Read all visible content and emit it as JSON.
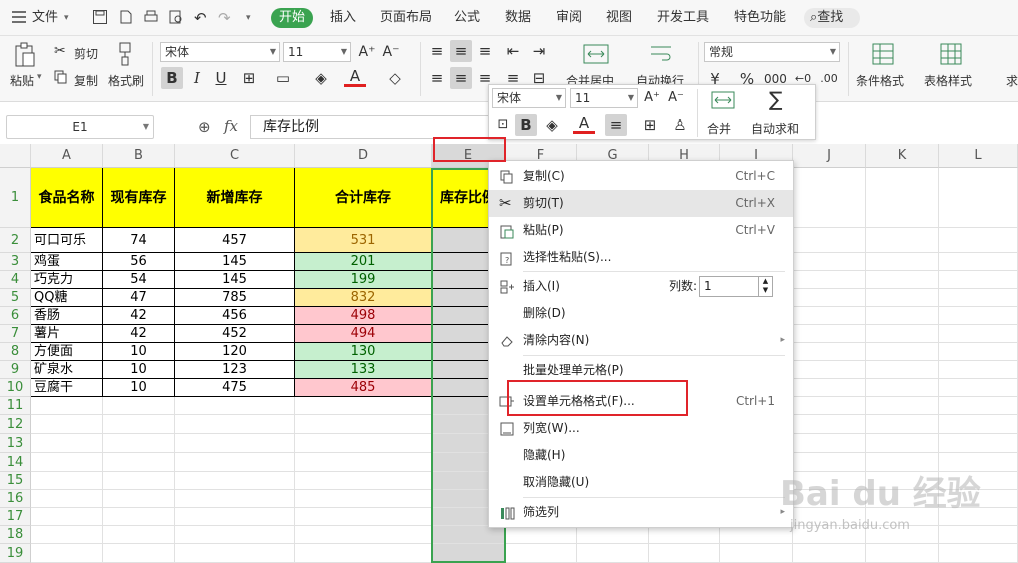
{
  "menu": {
    "file": "文件",
    "tabs": [
      "开始",
      "插入",
      "页面布局",
      "公式",
      "数据",
      "审阅",
      "视图",
      "开发工具",
      "特色功能"
    ],
    "active_tab": "开始",
    "search": "查找"
  },
  "ribbon": {
    "paste": "粘贴",
    "cut": "剪切",
    "copy": "复制",
    "format_painter": "格式刷",
    "font_name": "宋体",
    "font_size": "11",
    "merge_center": "合并居中",
    "wrap_text": "自动换行",
    "number_format": "常规",
    "conditional_format": "条件格式",
    "table_style": "表格样式",
    "more": "求"
  },
  "formula_bar": {
    "name_box": "E1",
    "fx": "fx",
    "value": "库存比例"
  },
  "columns": [
    "A",
    "B",
    "C",
    "D",
    "E",
    "F",
    "G",
    "H",
    "I",
    "J",
    "K",
    "L"
  ],
  "selected_column": "E",
  "rows": [
    "1",
    "2",
    "3",
    "4",
    "5",
    "6",
    "7",
    "8",
    "9",
    "10",
    "11",
    "12",
    "13",
    "14",
    "15",
    "16",
    "17",
    "18",
    "19"
  ],
  "table": {
    "headers": [
      "食品名称",
      "现有库存",
      "新增库存",
      "合计库存",
      "库存比例"
    ],
    "rows": [
      {
        "name": "可口可乐",
        "current": "74",
        "added": "457",
        "total": "531",
        "tone": "yellow"
      },
      {
        "name": "鸡蛋",
        "current": "56",
        "added": "145",
        "total": "201",
        "tone": "green"
      },
      {
        "name": "巧克力",
        "current": "54",
        "added": "145",
        "total": "199",
        "tone": "green"
      },
      {
        "name": "QQ糖",
        "current": "47",
        "added": "785",
        "total": "832",
        "tone": "yellow"
      },
      {
        "name": "香肠",
        "current": "42",
        "added": "456",
        "total": "498",
        "tone": "red"
      },
      {
        "name": "薯片",
        "current": "42",
        "added": "452",
        "total": "494",
        "tone": "red"
      },
      {
        "name": "方便面",
        "current": "10",
        "added": "120",
        "total": "130",
        "tone": "green"
      },
      {
        "name": "矿泉水",
        "current": "10",
        "added": "123",
        "total": "133",
        "tone": "green"
      },
      {
        "name": "豆腐干",
        "current": "10",
        "added": "475",
        "total": "485",
        "tone": "red"
      }
    ]
  },
  "mini_toolbar": {
    "font_name": "宋体",
    "font_size": "11",
    "merge": "合并",
    "autosum": "自动求和"
  },
  "context_menu": {
    "copy": {
      "label": "复制(C)",
      "shortcut": "Ctrl+C"
    },
    "cut": {
      "label": "剪切(T)",
      "shortcut": "Ctrl+X"
    },
    "paste": {
      "label": "粘贴(P)",
      "shortcut": "Ctrl+V"
    },
    "paste_special": {
      "label": "选择性粘贴(S)..."
    },
    "insert": {
      "label": "插入(I)",
      "count_label": "列数:",
      "count_value": "1"
    },
    "delete": {
      "label": "删除(D)"
    },
    "clear": {
      "label": "清除内容(N)"
    },
    "batch": {
      "label": "批量处理单元格(P)"
    },
    "format_cells": {
      "label": "设置单元格格式(F)...",
      "shortcut": "Ctrl+1"
    },
    "col_width": {
      "label": "列宽(W)..."
    },
    "hide": {
      "label": "隐藏(H)"
    },
    "unhide": {
      "label": "取消隐藏(U)"
    },
    "filter": {
      "label": "筛选列"
    }
  },
  "watermark": {
    "brand": "Bai du 经验",
    "url": "jingyan.baidu.com"
  },
  "colors": {
    "accent": "#3aa350",
    "header_fill": "#ffff00",
    "highlight_box": "#e0242a"
  }
}
